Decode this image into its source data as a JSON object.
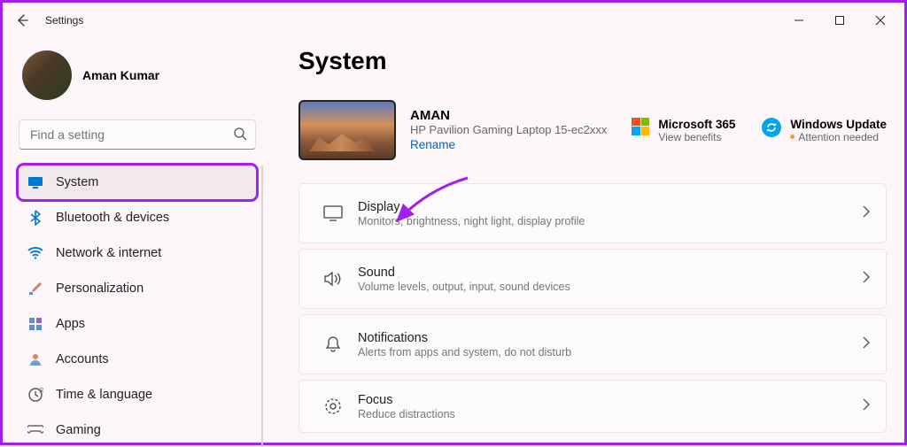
{
  "window": {
    "title": "Settings"
  },
  "user": {
    "name": "Aman Kumar",
    "sub": " "
  },
  "search": {
    "placeholder": "Find a setting"
  },
  "nav": [
    {
      "label": "System",
      "active": true,
      "icon": "display"
    },
    {
      "label": "Bluetooth & devices",
      "icon": "bluetooth"
    },
    {
      "label": "Network & internet",
      "icon": "wifi"
    },
    {
      "label": "Personalization",
      "icon": "brush"
    },
    {
      "label": "Apps",
      "icon": "apps"
    },
    {
      "label": "Accounts",
      "icon": "account"
    },
    {
      "label": "Time & language",
      "icon": "time"
    },
    {
      "label": "Gaming",
      "icon": "gaming"
    }
  ],
  "page": {
    "heading": "System"
  },
  "device": {
    "name": "AMAN",
    "model": "HP Pavilion Gaming Laptop 15-ec2xxx",
    "rename": "Rename"
  },
  "tiles": {
    "ms365": {
      "title": "Microsoft 365",
      "sub": "View benefits"
    },
    "wu": {
      "title": "Windows Update",
      "sub": "Attention needed"
    }
  },
  "rows": [
    {
      "title": "Display",
      "sub": "Monitors, brightness, night light, display profile"
    },
    {
      "title": "Sound",
      "sub": "Volume levels, output, input, sound devices"
    },
    {
      "title": "Notifications",
      "sub": "Alerts from apps and system, do not disturb"
    },
    {
      "title": "Focus",
      "sub": "Reduce distractions"
    }
  ]
}
